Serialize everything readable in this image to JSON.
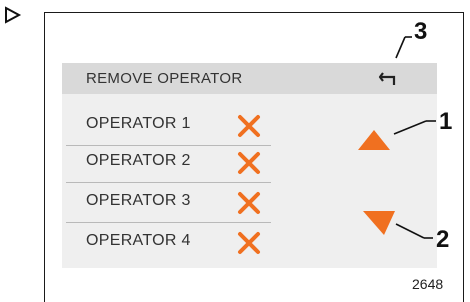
{
  "screen": {
    "title": "REMOVE OPERATOR",
    "operators": [
      {
        "label": "OPERATOR 1"
      },
      {
        "label": "OPERATOR 2"
      },
      {
        "label": "OPERATOR 3"
      },
      {
        "label": "OPERATOR 4"
      }
    ]
  },
  "icons": {
    "step": "step-triangle-icon",
    "back": "return-arrow-icon",
    "delete": "x-delete-icon",
    "scroll_up": "triangle-up-icon",
    "scroll_down": "triangle-down-icon"
  },
  "callouts": {
    "c1": "1",
    "c2": "2",
    "c3": "3"
  },
  "figure_id": "2648",
  "colors": {
    "accent": "#f07020",
    "header_bg": "#d9d9d9",
    "screen_bg": "#efefef"
  }
}
